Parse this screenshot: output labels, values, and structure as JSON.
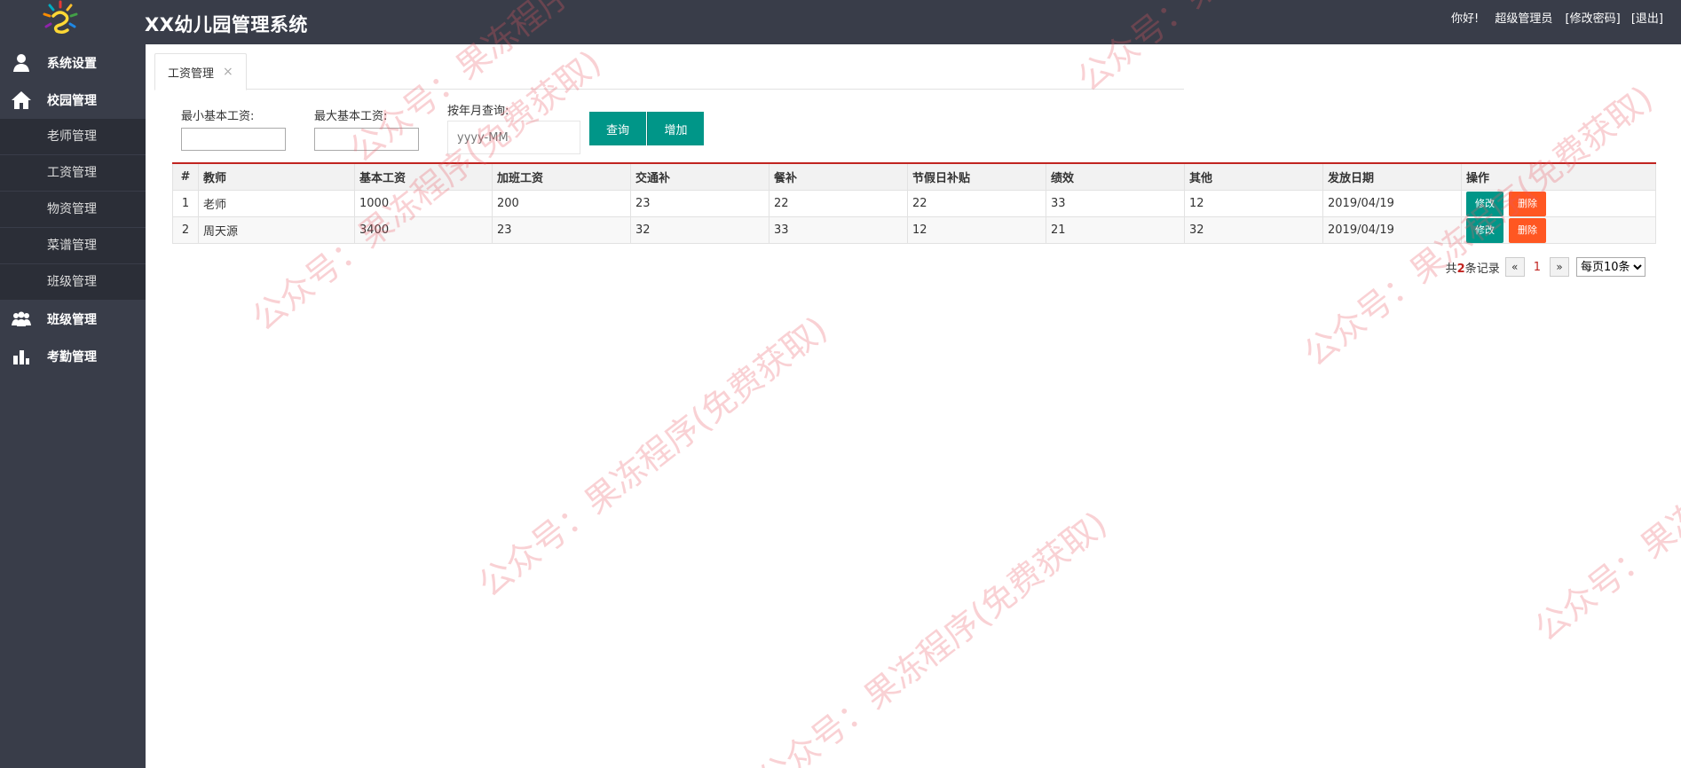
{
  "header": {
    "title": "XX幼儿园管理系统",
    "greeting": "你好!",
    "username": "超级管理员",
    "change_password": "[修改密码]",
    "logout": "[退出]"
  },
  "sidebar": {
    "groups": [
      {
        "label": "系统设置",
        "icon": "user-icon"
      },
      {
        "label": "校园管理",
        "icon": "home-icon",
        "children": [
          "老师管理",
          "工资管理",
          "物资管理",
          "菜谱管理",
          "班级管理"
        ]
      },
      {
        "label": "班级管理",
        "icon": "group-icon"
      },
      {
        "label": "考勤管理",
        "icon": "bar-chart-icon"
      }
    ]
  },
  "tabs": [
    {
      "label": "工资管理",
      "close": "×"
    }
  ],
  "search": {
    "min_label": "最小基本工资:",
    "max_label": "最大基本工资:",
    "month_label": "按年月查询:",
    "month_placeholder": "yyyy-MM",
    "query_button": "查询",
    "add_button": "增加"
  },
  "table": {
    "columns": [
      "#",
      "教师",
      "基本工资",
      "加班工资",
      "交通补",
      "餐补",
      "节假日补贴",
      "绩效",
      "其他",
      "发放日期",
      "操作"
    ],
    "rows": [
      {
        "idx": "1",
        "teacher": "老师",
        "base": "1000",
        "overtime": "200",
        "transport": "23",
        "meal": "22",
        "holiday": "22",
        "performance": "33",
        "other": "12",
        "date": "2019/04/19"
      },
      {
        "idx": "2",
        "teacher": "周天源",
        "base": "3400",
        "overtime": "23",
        "transport": "32",
        "meal": "33",
        "holiday": "12",
        "performance": "21",
        "other": "32",
        "date": "2019/04/19"
      }
    ],
    "edit_label": "修改",
    "delete_label": "删除"
  },
  "pager": {
    "total_prefix": "共",
    "total_count": "2",
    "total_suffix": "条记录",
    "prev": "«",
    "current": "1",
    "next": "»",
    "page_size": "每页10条"
  },
  "watermark": "公众号：果冻程序(免费获取)",
  "colors": {
    "header_bg": "#393d49",
    "submenu_bg": "#2b2e37",
    "primary": "#009688",
    "danger": "#ff5722",
    "table_top_border": "#c12420"
  }
}
